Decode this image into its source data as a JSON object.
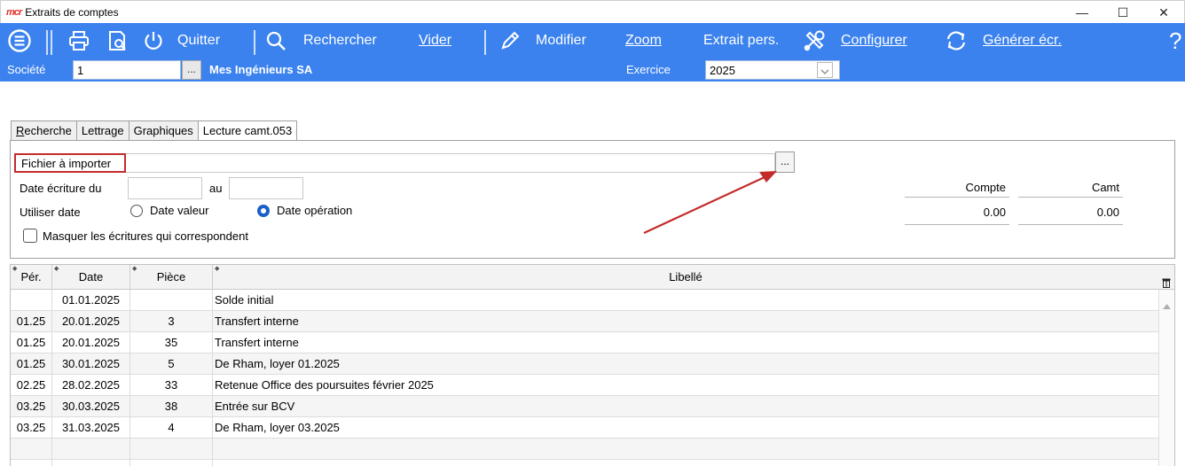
{
  "window": {
    "logo": "mcr",
    "title": "Extraits de comptes",
    "minimize": "—",
    "maximize": "☐",
    "close": "✕"
  },
  "toolbar": {
    "quit_label": "Quitter",
    "search_label": "Rechercher",
    "clear_label": "Vider",
    "edit_label": "Modifier",
    "zoom_label": "Zoom",
    "extract_label": "Extrait pers.",
    "configure_label": "Configurer",
    "generate_label": "Générer écr.",
    "help_label": "?"
  },
  "company": {
    "label": "Société",
    "value": "1",
    "lookup_label": "...",
    "name": "Mes Ingénieurs SA"
  },
  "fiscal_year": {
    "label": "Exercice",
    "value": "2025"
  },
  "tabs": [
    {
      "label": "Recherche",
      "accel": "R"
    },
    {
      "label": "Lettrage"
    },
    {
      "label": "Graphiques"
    },
    {
      "label": "Lecture camt.053"
    }
  ],
  "import_panel": {
    "file_label": "Fichier à importer",
    "file_value": "",
    "browse_label": "...",
    "date_label": "Date écriture du",
    "date_to_label": "au",
    "date_from": "",
    "date_to": "",
    "use_date_label": "Utiliser date",
    "radio_value_date": "Date valeur",
    "radio_operation_date": "Date opération",
    "selected_radio": "Date opération",
    "hide_matching_label": "Masquer les écritures qui correspondent",
    "hide_matching_checked": false,
    "summary": {
      "compte_label": "Compte",
      "camt_label": "Camt",
      "compte_value": "0.00",
      "camt_value": "0.00"
    }
  },
  "grid": {
    "columns": [
      "Pér.",
      "Date",
      "Pièce",
      "Libellé"
    ],
    "rows": [
      {
        "per": "",
        "date": "01.01.2025",
        "piece": "",
        "libelle": "Solde initial"
      },
      {
        "per": "01.25",
        "date": "20.01.2025",
        "piece": "3",
        "libelle": "Transfert interne"
      },
      {
        "per": "01.25",
        "date": "20.01.2025",
        "piece": "35",
        "libelle": "Transfert interne"
      },
      {
        "per": "01.25",
        "date": "30.01.2025",
        "piece": "5",
        "libelle": "De Rham, loyer 01.2025"
      },
      {
        "per": "02.25",
        "date": "28.02.2025",
        "piece": "33",
        "libelle": "Retenue Office des poursuites février 2025"
      },
      {
        "per": "03.25",
        "date": "30.03.2025",
        "piece": "38",
        "libelle": "Entrée sur BCV"
      },
      {
        "per": "03.25",
        "date": "31.03.2025",
        "piece": "4",
        "libelle": "De Rham, loyer 03.2025"
      },
      {
        "per": "",
        "date": "",
        "piece": "",
        "libelle": ""
      },
      {
        "per": "",
        "date": "",
        "piece": "",
        "libelle": ""
      }
    ]
  },
  "colors": {
    "toolbar_bg": "#3b82ee",
    "highlight_border": "#c42b2b",
    "annotation_arrow": "#c42b2b",
    "radio_selected": "#1a5fc9"
  },
  "icons": {
    "menu": "menu-circle-icon",
    "print": "printer-icon",
    "preview": "print-preview-icon",
    "quit": "power-icon",
    "search": "search-icon",
    "edit": "pencil-icon",
    "configure": "tools-icon",
    "generate": "refresh-icon"
  }
}
